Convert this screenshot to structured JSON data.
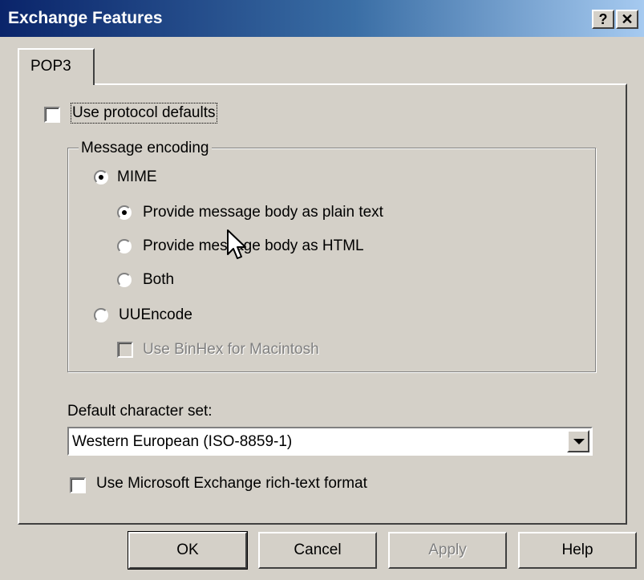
{
  "window": {
    "title": "Exchange Features",
    "help_glyph": "?",
    "close_glyph": "✕"
  },
  "tabs": [
    {
      "label": "POP3",
      "selected": true
    }
  ],
  "use_protocol_defaults": {
    "label": "Use protocol defaults",
    "checked": false
  },
  "message_encoding": {
    "legend": "Message encoding",
    "mime": {
      "label": "MIME",
      "selected": true
    },
    "plain_text": {
      "label": "Provide message body as plain text",
      "selected": true
    },
    "html": {
      "label": "Provide message body as HTML",
      "selected": false
    },
    "both": {
      "label": "Both",
      "selected": false
    },
    "uuencode": {
      "label": "UUEncode",
      "selected": false
    },
    "binhex": {
      "label": "Use BinHex for Macintosh",
      "checked": false,
      "enabled": false
    }
  },
  "charset": {
    "label": "Default character set:",
    "value": "Western European (ISO-8859-1)"
  },
  "rich_text": {
    "label": "Use Microsoft Exchange rich-text format",
    "checked": false
  },
  "buttons": {
    "ok": "OK",
    "cancel": "Cancel",
    "apply": "Apply",
    "help": "Help"
  },
  "colors": {
    "title_start": "#0a246a",
    "title_end": "#a6caf0",
    "face": "#d4d0c8"
  }
}
